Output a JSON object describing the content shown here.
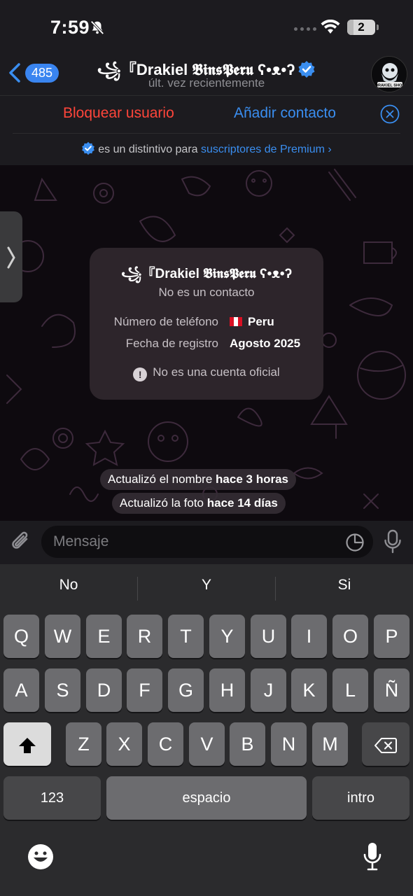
{
  "status_bar": {
    "time": "7:59",
    "battery": "2"
  },
  "header": {
    "back_count": "485",
    "title": "꧁『Drakiel 𝕭𝖎𝖓𝖘𝕻𝖊𝖗𝖚 ʕ•ᴥ•ʔ",
    "subtitle": "últ. vez recientemente",
    "avatar_text": "DRAKIEL SHOP"
  },
  "actions": {
    "block_label": "Bloquear usuario",
    "add_label": "Añadir contacto",
    "premium_text": "es un distintivo para",
    "premium_link": "suscriptores de Premium"
  },
  "info_card": {
    "name": "꧁『Drakiel 𝕭𝖎𝖓𝖘𝕻𝖊𝖗𝖚 ʕ•ᴥ•ʔ",
    "status": "No es un contacto",
    "rows": [
      {
        "label": "Número de teléfono",
        "value": "Peru"
      },
      {
        "label": "Fecha de registro",
        "value": "Agosto 2025"
      }
    ],
    "warning": "No es una cuenta oficial"
  },
  "system_messages": [
    {
      "prefix": "Actualizó el nombre",
      "bold": "hace 3 horas"
    },
    {
      "prefix": "Actualizó la foto",
      "bold": "hace 14 días"
    }
  ],
  "input": {
    "placeholder": "Mensaje"
  },
  "keyboard": {
    "suggestions": [
      "No",
      "Y",
      "Si"
    ],
    "row1": [
      "Q",
      "W",
      "E",
      "R",
      "T",
      "Y",
      "U",
      "I",
      "O",
      "P"
    ],
    "row2": [
      "A",
      "S",
      "D",
      "F",
      "G",
      "H",
      "J",
      "K",
      "L",
      "Ñ"
    ],
    "row3": [
      "Z",
      "X",
      "C",
      "V",
      "B",
      "N",
      "M"
    ],
    "numbers_key": "123",
    "space_key": "espacio",
    "return_key": "intro"
  },
  "colors": {
    "accent": "#3a8ef0",
    "danger": "#ff453a",
    "bar_bg": "#1c1b1f",
    "keyboard_bg": "#2b2b2d"
  }
}
